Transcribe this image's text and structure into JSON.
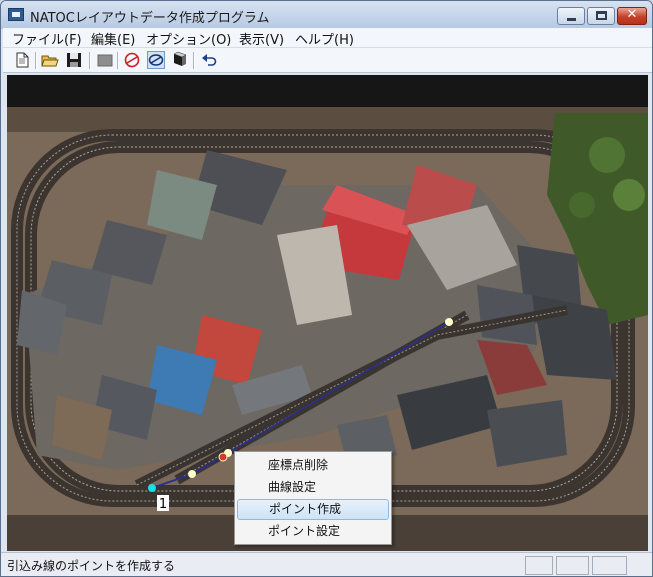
{
  "window": {
    "title": "NATOCレイアウトデータ作成プログラム",
    "icon": "app-icon",
    "controls": [
      "minimize-icon",
      "maximize-icon",
      "close-icon"
    ],
    "close_glyph": "✕"
  },
  "menu": [
    {
      "label": "ファイル(F)"
    },
    {
      "label": "編集(E)"
    },
    {
      "label": "オプション(O)"
    },
    {
      "label": "表示(V)"
    },
    {
      "label": "ヘルプ(H)"
    }
  ],
  "toolbar": {
    "buttons": [
      "new-document-icon",
      "open-folder-icon",
      "save-icon",
      "stop-icon",
      "no-entry-icon",
      "ellipse-select-icon",
      "wagon-icon",
      "undo-icon"
    ]
  },
  "canvas": {
    "point_label": "1",
    "track_color": "#2c2f8a",
    "point_colors": {
      "start": "#18e0e8",
      "mid": "#ffffcc",
      "selected": "#d8382a"
    }
  },
  "context_menu": {
    "items": [
      {
        "label": "座標点削除"
      },
      {
        "label": "曲線設定"
      },
      {
        "label": "ポイント作成"
      },
      {
        "label": "ポイント設定"
      }
    ],
    "highlighted_index": 2
  },
  "status_bar": {
    "text": "引込み線のポイントを作成する",
    "panes": [
      "",
      "",
      ""
    ]
  }
}
